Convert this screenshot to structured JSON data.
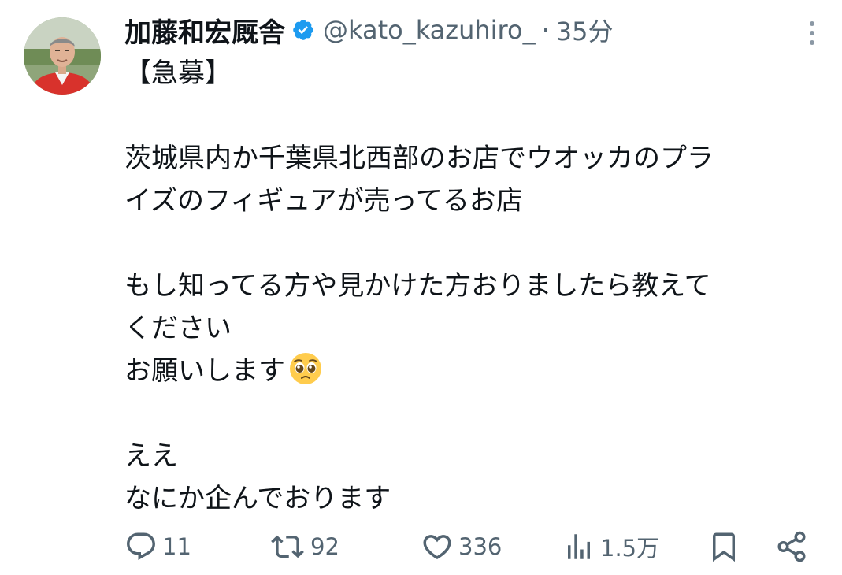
{
  "tweet": {
    "display_name": "加藤和宏厩舎",
    "handle": "@kato_kazuhiro_",
    "separator": "·",
    "time": "35分",
    "lines": [
      "【急募】",
      "",
      "茨城県内か千葉県北西部のお店でウオッカのプラ",
      "イズのフィギュアが売ってるお店",
      "",
      "もし知ってる方や見かけた方おりましたら教えて",
      "ください",
      "お願いします",
      "",
      "ええ",
      "なにか企んでおります"
    ],
    "emoji_icon": "pleading-face-emoji",
    "verified_icon": "verified-badge-icon",
    "verified_color": "#1d9bf0",
    "metrics": {
      "replies": "11",
      "retweets": "92",
      "likes": "336",
      "views": "1.5万"
    }
  },
  "colors": {
    "text": "#0f1419",
    "secondary": "#536471",
    "accent": "#1d9bf0"
  }
}
